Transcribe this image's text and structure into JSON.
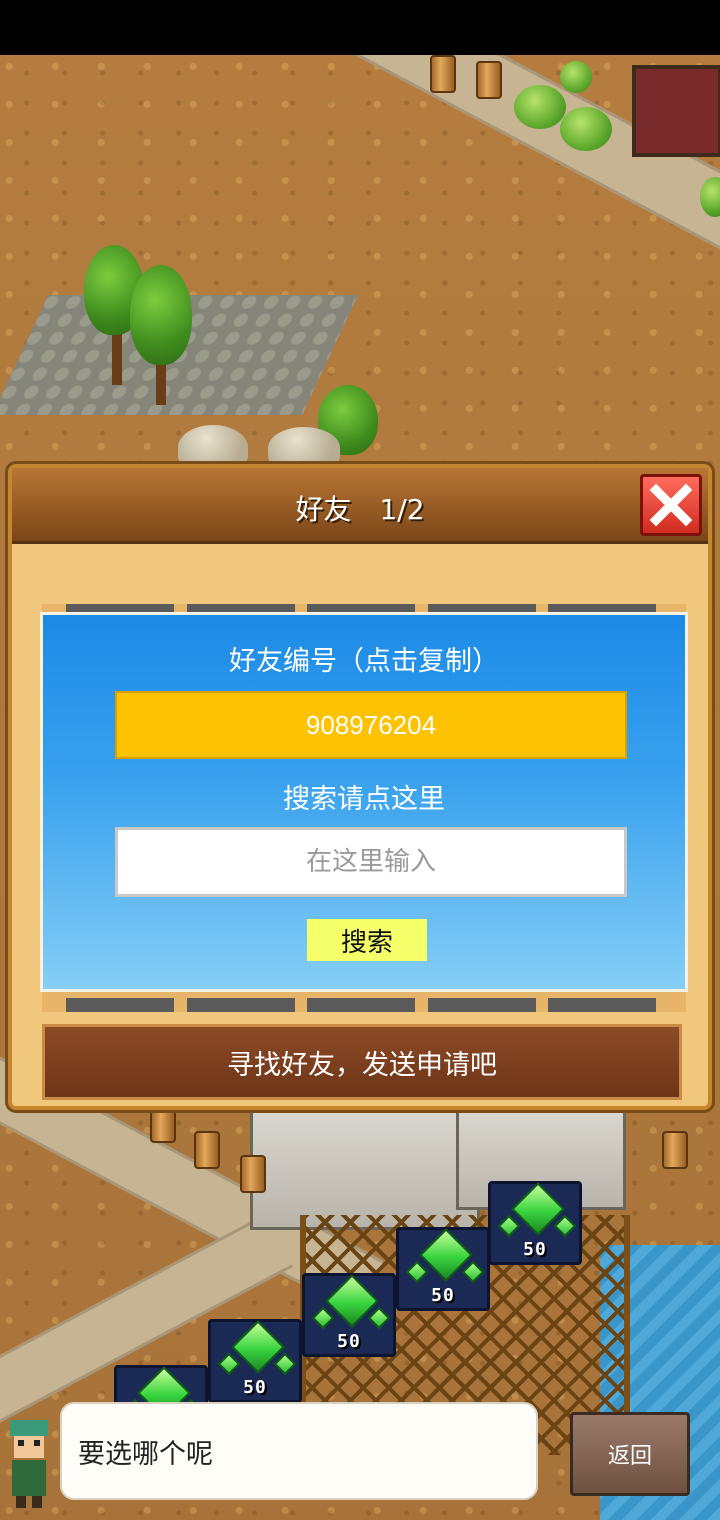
{
  "dialog": {
    "title": "好友　1/2",
    "friend_id_label": "好友编号（点击复制）",
    "friend_id": "908976204",
    "search_label": "搜索请点这里",
    "search_placeholder": "在这里输入",
    "search_button": "搜索",
    "hint": "寻找好友，发送申请吧"
  },
  "gem_tiles": [
    {
      "price": "50"
    },
    {
      "price": "50"
    },
    {
      "price": "50"
    },
    {
      "price": "50"
    }
  ],
  "bottom": {
    "npc_prompt": "要选哪个呢",
    "back_button": "返回"
  },
  "colors": {
    "id_box": "#fdc201",
    "panel_blue": "#1c8ae6",
    "close_red": "#d02b1f",
    "search_button": "#f4ff6a"
  }
}
